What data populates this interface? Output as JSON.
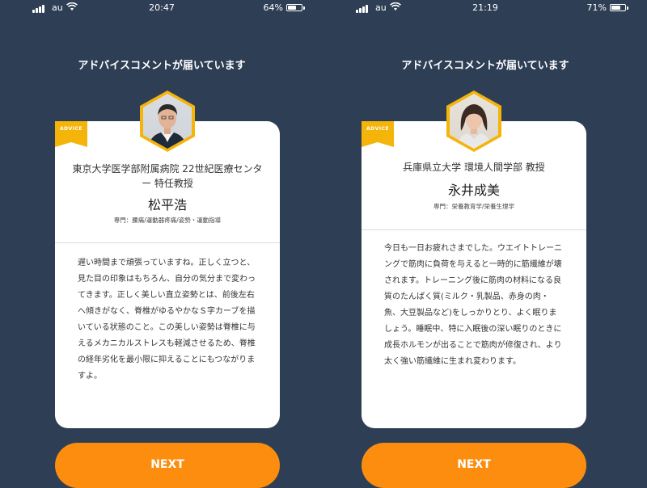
{
  "screens": [
    {
      "status": {
        "carrier": "au",
        "time": "20:47",
        "battery": "64%",
        "battery_level": 0.64
      },
      "heading": "アドバイスコメントが届いています",
      "card": {
        "badge": "ADVICE",
        "organization": "東京大学医学部附属病院 22世紀医療センター 特任教授",
        "name": "松平浩",
        "specialty": "専門：腰痛/運動器疼痛/姿勢・運動指導",
        "comment": "遅い時間まで頑張っていますね。正しく立つと、見た目の印象はもちろん、自分の気分まで変わってきます。正しく美しい直立姿勢とは、前後左右へ傾きがなく、脊椎がゆるやかなＳ字カーブを描いている状態のこと。この美しい姿勢は脊椎に与えるメカニカルストレスも軽減させるため、脊椎の経年劣化を最小限に抑えることにもつながりますよ。"
      },
      "button": "NEXT"
    },
    {
      "status": {
        "carrier": "au",
        "time": "21:19",
        "battery": "71%",
        "battery_level": 0.71
      },
      "heading": "アドバイスコメントが届いています",
      "card": {
        "badge": "ADVICE",
        "organization": "兵庫県立大学 環境人間学部 教授",
        "name": "永井成美",
        "specialty": "専門：栄養教育学/栄養生理学",
        "comment": "今日も一日お疲れさまでした。ウエイトトレーニングで筋肉に負荷を与えると一時的に筋繊維が壊されます。トレーニング後に筋肉の材料になる良質のたんぱく質(ミルク・乳製品、赤身の肉・魚、大豆製品など)をしっかりとり、よく眠りましょう。睡眠中、特に入眠後の深い眠りのときに成長ホルモンが出ることで筋肉が修復され、より太く強い筋繊維に生まれ変わります。"
      },
      "button": "NEXT"
    }
  ],
  "colors": {
    "background": "#2e3f55",
    "accent": "#f5b40a",
    "button": "#fd8d0f"
  },
  "icons": [
    "signal-icon",
    "wifi-icon",
    "battery-icon"
  ]
}
